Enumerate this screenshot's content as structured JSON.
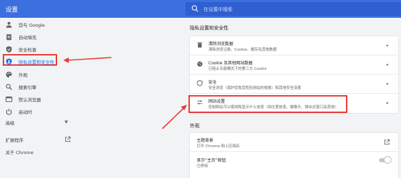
{
  "app": {
    "title": "设置"
  },
  "search": {
    "placeholder": "在设置中搜索"
  },
  "sidebar": {
    "items": [
      {
        "label": "您与 Google"
      },
      {
        "label": "自动填充"
      },
      {
        "label": "安全检查"
      },
      {
        "label": "隐私设置和安全性"
      },
      {
        "label": "外观"
      },
      {
        "label": "搜索引擎"
      },
      {
        "label": "默认浏览器"
      },
      {
        "label": "启动时"
      }
    ],
    "advanced": "高级",
    "extensions": "扩展程序",
    "about": "关于 Chrome"
  },
  "privacy": {
    "section_title": "隐私设置和安全性",
    "rows": [
      {
        "title": "清除浏览数据",
        "desc": "清除浏览记录、Cookie、缓存及其他数据"
      },
      {
        "title": "Cookie 及其他网站数据",
        "desc": "已阻止无痕模式下的第三方 Cookie"
      },
      {
        "title": "安全",
        "desc": "安全浏览（保护您免受危险网站的侵害）和其他安全设置"
      },
      {
        "title": "网站设置",
        "desc": "控制网站可以使用和显示什么信息（如位置信息、摄像头、弹出式窗口及其他）"
      }
    ]
  },
  "appearance": {
    "section_title": "外观",
    "rows": [
      {
        "title": "主题背景",
        "desc": "打开 Chrome 网上应用店"
      },
      {
        "title": "显示“主页”按钮",
        "desc": "已停用"
      }
    ]
  },
  "colors": {
    "accent": "#3c6fe0",
    "highlight": "#e53935",
    "link": "#1a73e8"
  }
}
